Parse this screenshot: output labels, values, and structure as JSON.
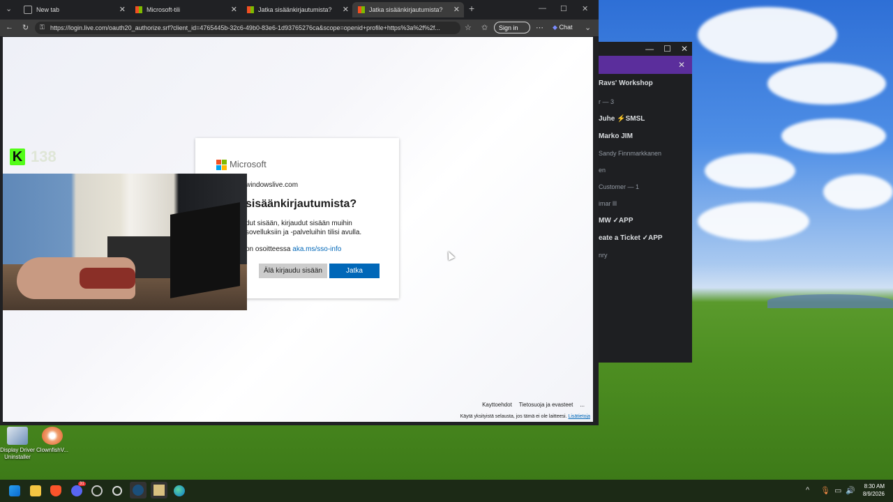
{
  "browser": {
    "tabs": [
      {
        "title": "New tab"
      },
      {
        "title": "Microsoft-tili"
      },
      {
        "title": "Jatka sisäänkirjautumista?"
      },
      {
        "title": "Jatka sisäänkirjautumista?"
      }
    ],
    "url": "https://login.live.com/oauth20_authorize.srf?client_id=4765445b-32c6-49b0-83e6-1d93765276ca&scope=openid+profile+https%3a%2f%2f...",
    "signin_label": "Sign in",
    "chat_label": "Chat"
  },
  "login": {
    "brand": "Microsoft",
    "email": "windowslive.com",
    "title": "sisäänkirjautumista?",
    "description": "dut sisään, kirjaudut sisään muihin sovelluksiin ja -palveluihin tilisi avulla.",
    "info_prefix": "on osoitteessa",
    "info_link": "aka.ms/sso-info",
    "secondary_button": "Älä kirjaudu sisään",
    "primary_button": "Jatka"
  },
  "footer": {
    "terms": "Kayttoehdot",
    "privacy": "Tietosuoja ja evasteet",
    "more": "...",
    "note": "Käytä yksityistä selausta, jos tämä ei ole laitteesi.",
    "note_link": "Lisätietoja"
  },
  "overlay": {
    "kick_logo": "K",
    "viewer_count": "138"
  },
  "dark_window": {
    "server": "Ravs' Workshop",
    "rows": [
      {
        "text": "r — 3",
        "style": "dim"
      },
      {
        "text": "Juhe  ⚡SMSL",
        "style": "w"
      },
      {
        "text": "Marko  JIM",
        "style": "w"
      },
      {
        "text": "Sandy Finnmarkkanen",
        "style": "dim"
      },
      {
        "text": "en",
        "style": "dim"
      },
      {
        "text": "Customer — 1",
        "style": "dim"
      },
      {
        "text": "imar lll",
        "style": "dim"
      },
      {
        "text": "MW  ✓APP",
        "style": "w"
      },
      {
        "text": "eate a Ticket  ✓APP",
        "style": "w"
      },
      {
        "text": "nry",
        "style": "dim"
      }
    ]
  },
  "desktop": {
    "icons": [
      {
        "label": "Display Driver Uninstaller",
        "icon": "ddu-icon"
      },
      {
        "label": "ClownfishV...",
        "icon": "clownfish-icon"
      }
    ]
  },
  "taskbar": {
    "time": "8:30 AM",
    "date": "8/9/2026",
    "discord_badge": "31"
  }
}
